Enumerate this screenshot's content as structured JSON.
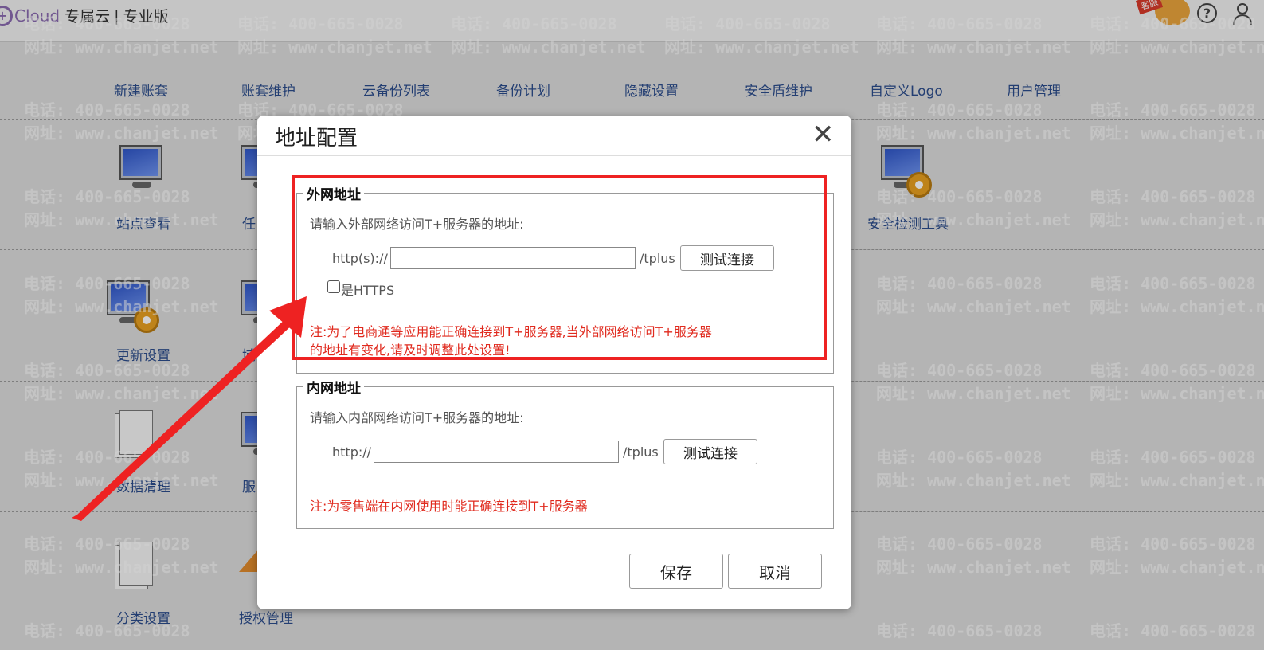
{
  "header": {
    "logo_mark": "+",
    "logo_text": "Cloud",
    "product": "专属云",
    "separator": "|",
    "edition": "专业版",
    "support_tag": "客服",
    "help_glyph": "?"
  },
  "watermark": {
    "phone": "电话: 400-665-0028",
    "site": "网址: www.chanjet.net"
  },
  "nav": {
    "items": [
      "新建账套",
      "账套维护",
      "云备份列表",
      "备份计划",
      "隐藏设置",
      "安全盾维护",
      "自定义Logo",
      "用户管理"
    ]
  },
  "tiles": {
    "site_view": "站点查看",
    "task_partial": "任",
    "security_tool": "安全检测工具",
    "update_settings": "更新设置",
    "domain_partial": "域",
    "data_cleanup": "数据清理",
    "service_partial": "服",
    "category_settings": "分类设置",
    "license_management": "授权管理"
  },
  "dialog": {
    "title": "地址配置",
    "close_glyph": "✕",
    "external": {
      "legend": "外网地址",
      "hint": "请输入外部网络访问T+服务器的地址:",
      "prefix": "http(s)://",
      "value": "",
      "suffix": "/tplus",
      "test_button": "测试连接",
      "https_label": "是HTTPS",
      "note_line1": "注:为了电商通等应用能正确连接到T+服务器,当外部网络访问T+服务器",
      "note_line2": "的地址有变化,请及时调整此处设置!"
    },
    "internal": {
      "legend": "内网地址",
      "hint": "请输入内部网络访问T+服务器的地址:",
      "prefix": "http://",
      "value": "",
      "suffix": "/tplus",
      "test_button": "测试连接",
      "note": "注:为零售端在内网使用时能正确连接到T+服务器"
    },
    "save_button": "保存",
    "cancel_button": "取消"
  },
  "colors": {
    "accent_blue": "#2b4c8c",
    "note_red": "#e02a1e",
    "highlight_red": "#ee2222",
    "logo_purple": "#8a6bb0"
  }
}
